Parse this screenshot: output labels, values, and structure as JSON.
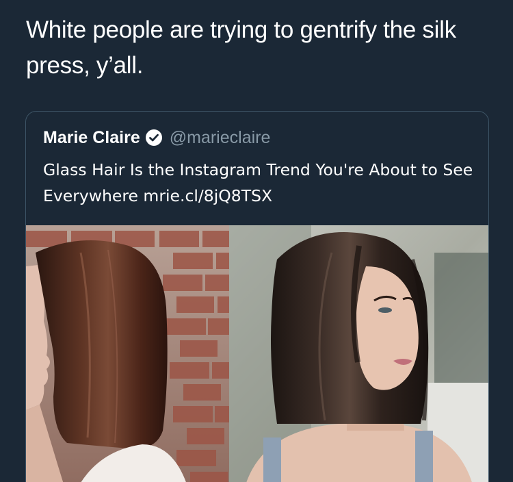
{
  "tweet": {
    "text": "White people are trying to gentrify the silk press, y’all."
  },
  "quoted_tweet": {
    "author_name": "Marie Claire",
    "verified": true,
    "author_handle": "@marieclaire",
    "text": "Glass Hair Is the Instagram Trend You're About to See Everywhere mrie.cl/8jQ8TSX"
  },
  "media": {
    "photos": [
      {
        "description_icon": "photo-profile-bob-brick-wall"
      },
      {
        "description_icon": "photo-front-bob-glass-hair"
      }
    ]
  },
  "colors": {
    "background": "#1b2836",
    "card_border": "#3d5466",
    "handle": "#8899a6",
    "text": "#ffffff"
  }
}
